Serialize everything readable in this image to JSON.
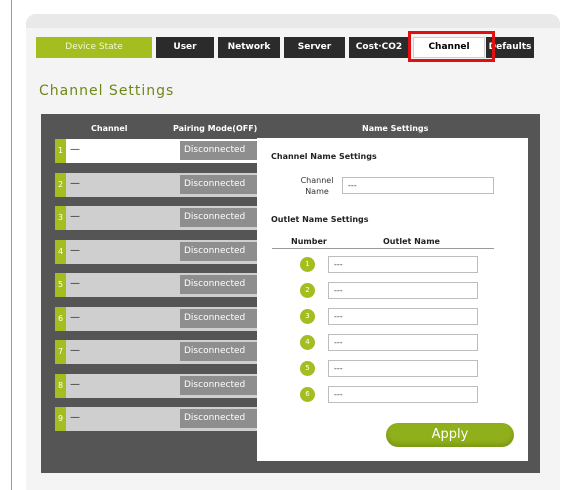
{
  "colors": {
    "accent": "#a3be1e",
    "dark": "#2b2b2b",
    "panel": "#555555",
    "highlight": "#e01010"
  },
  "nav": {
    "tabs": [
      {
        "label": "Device State",
        "state": "active"
      },
      {
        "label": "User",
        "state": "normal"
      },
      {
        "label": "Network",
        "state": "normal"
      },
      {
        "label": "Server",
        "state": "normal"
      },
      {
        "label": "Cost·CO2",
        "state": "normal"
      },
      {
        "label": "Channel",
        "state": "selected"
      },
      {
        "label": "Defaults",
        "state": "normal"
      }
    ]
  },
  "page": {
    "title": "Channel Settings"
  },
  "table": {
    "headers": {
      "channel": "Channel",
      "pairing": "Pairing Mode(OFF)",
      "names": "Name Settings"
    },
    "rows": [
      {
        "number": "1",
        "name": "—",
        "status": "Disconnected"
      },
      {
        "number": "2",
        "name": "—",
        "status": "Disconnected"
      },
      {
        "number": "3",
        "name": "—",
        "status": "Disconnected"
      },
      {
        "number": "4",
        "name": "—",
        "status": "Disconnected"
      },
      {
        "number": "5",
        "name": "—",
        "status": "Disconnected"
      },
      {
        "number": "6",
        "name": "—",
        "status": "Disconnected"
      },
      {
        "number": "7",
        "name": "—",
        "status": "Disconnected"
      },
      {
        "number": "8",
        "name": "—",
        "status": "Disconnected"
      },
      {
        "number": "9",
        "name": "—",
        "status": "Disconnected"
      }
    ]
  },
  "name_settings": {
    "channel_section_title": "Channel Name Settings",
    "channel_label": "Channel\nName",
    "channel_value": "---",
    "outlet_section_title": "Outlet Name Settings",
    "col_number": "Number",
    "col_outlet_name": "Outlet Name",
    "outlets": [
      {
        "number": "1",
        "value": "---"
      },
      {
        "number": "2",
        "value": "---"
      },
      {
        "number": "3",
        "value": "---"
      },
      {
        "number": "4",
        "value": "---"
      },
      {
        "number": "5",
        "value": "---"
      },
      {
        "number": "6",
        "value": "---"
      }
    ],
    "apply_label": "Apply"
  }
}
